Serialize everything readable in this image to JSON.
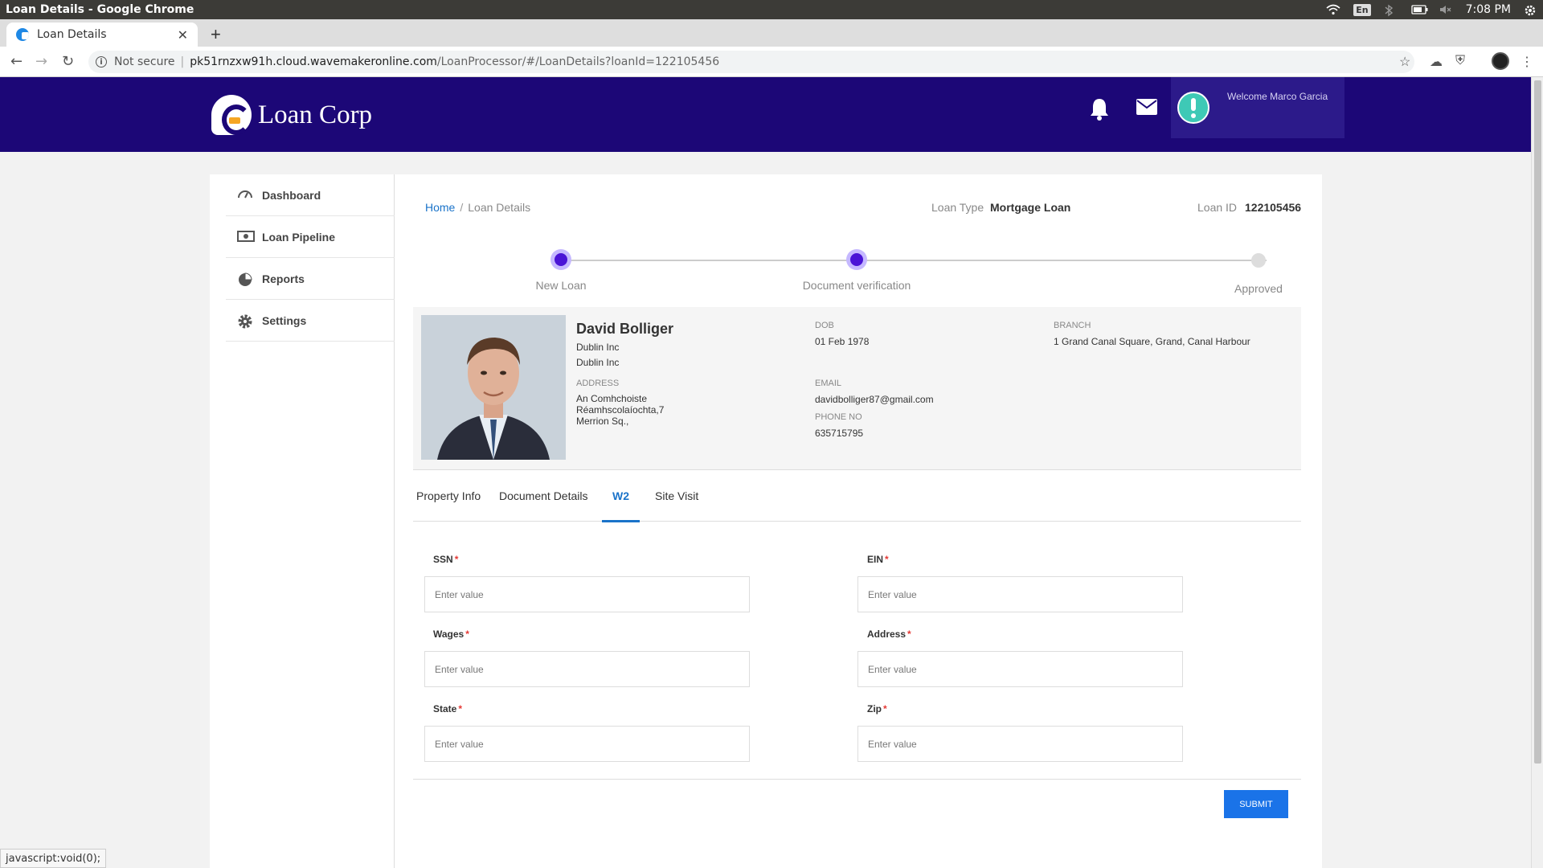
{
  "os": {
    "window_title": "Loan Details - Google Chrome",
    "lang": "En",
    "time": "7:08 PM"
  },
  "browser": {
    "tab_title": "Loan Details",
    "security": "Not secure",
    "url_host": "pk51rnzxw91h.cloud.wavemakeronline.com",
    "url_path": "/LoanProcessor/#/LoanDetails?loanId=122105456"
  },
  "header": {
    "logo_text": "Loan Corp",
    "welcome": "Welcome Marco Garcia"
  },
  "sidebar": {
    "items": [
      {
        "label": "Dashboard",
        "icon": "gauge-icon"
      },
      {
        "label": "Loan Pipeline",
        "icon": "money-icon"
      },
      {
        "label": "Reports",
        "icon": "pie-chart-icon"
      },
      {
        "label": "Settings",
        "icon": "gear-icon"
      }
    ]
  },
  "breadcrumb": {
    "home": "Home",
    "sep": "/",
    "current": "Loan Details"
  },
  "loan": {
    "type_label": "Loan Type",
    "type_value": "Mortgage Loan",
    "id_label": "Loan ID",
    "id_value": "122105456"
  },
  "stepper": {
    "steps": [
      "New Loan",
      "Document verification",
      "Approved"
    ]
  },
  "profile": {
    "name": "David Bolliger",
    "company1": "Dublin Inc",
    "company2": "Dublin Inc",
    "address_label": "ADDRESS",
    "address_lines": [
      "An Comhchoiste",
      "Réamhscolaíochta,7",
      "Merrion Sq.,"
    ],
    "dob_label": "DOB",
    "dob": "01 Feb 1978",
    "branch_label": "BRANCH",
    "branch": "1 Grand Canal Square, Grand, Canal Harbour",
    "email_label": "EMAIL",
    "email": "davidbolliger87@gmail.com",
    "phone_label": "PHONE NO",
    "phone": "635715795"
  },
  "tabs": [
    "Property Info",
    "Document Details",
    "W2",
    "Site Visit"
  ],
  "active_tab": "W2",
  "form": {
    "required_mark": "*",
    "placeholder": "Enter value",
    "fields": [
      "SSN",
      "EIN",
      "Wages",
      "Address",
      "State",
      "Zip"
    ],
    "submit": "SUBMIT"
  },
  "status_tip": "javascript:void(0);",
  "colors": {
    "header": "#1c0777",
    "accent": "#1a73c9",
    "step": "#4a14d6",
    "submit": "#1a73e8"
  }
}
